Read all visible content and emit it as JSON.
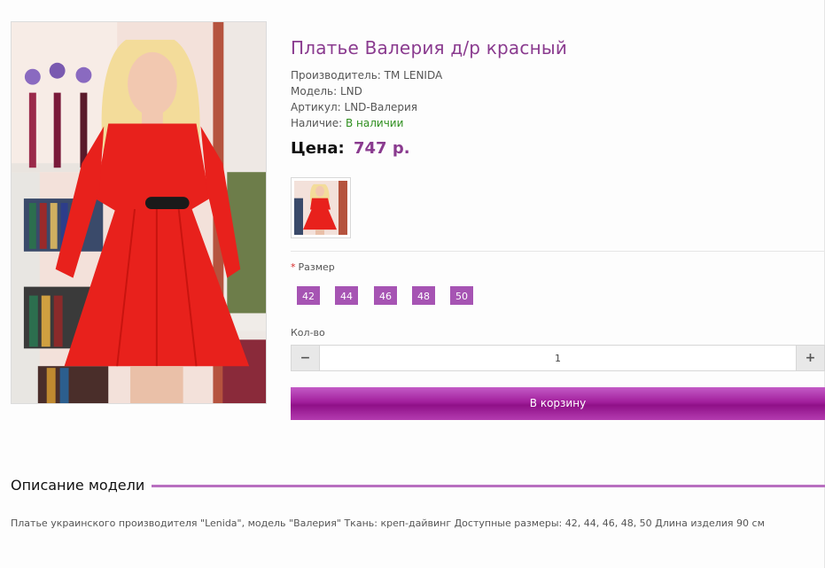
{
  "product": {
    "title": "Платье Валерия д/р красный",
    "specs": [
      {
        "label": "Производитель:",
        "value": "TM LENIDA"
      },
      {
        "label": "Модель:",
        "value": "LND"
      },
      {
        "label": "Артикул:",
        "value": "LND-Валерия"
      },
      {
        "label": "Наличие:",
        "value": "В наличии",
        "color": "#2f8f1f"
      }
    ],
    "price_label": "Цена:",
    "price_value": "747 р."
  },
  "options": {
    "size_required_mark": "*",
    "size_label": "Размер",
    "sizes": [
      "42",
      "44",
      "46",
      "48",
      "50"
    ],
    "qty_label": "Кол-во",
    "qty_value": "1",
    "qty_minus": "−",
    "qty_plus": "+"
  },
  "cart": {
    "button_label": "В корзину"
  },
  "description": {
    "heading": "Описание модели",
    "text": "Платье украинского производителя \"Lenida\", модель \"Валерия\" Ткань: креп-дайвинг Доступные размеры: 42, 44, 46, 48, 50 Длина изделия 90 см"
  },
  "colors": {
    "accent": "#8a3b8f",
    "size_button": "#a654b3",
    "in_stock": "#2f8f1f",
    "required": "#d62828",
    "cart_gradient_mid": "#8f1088"
  }
}
